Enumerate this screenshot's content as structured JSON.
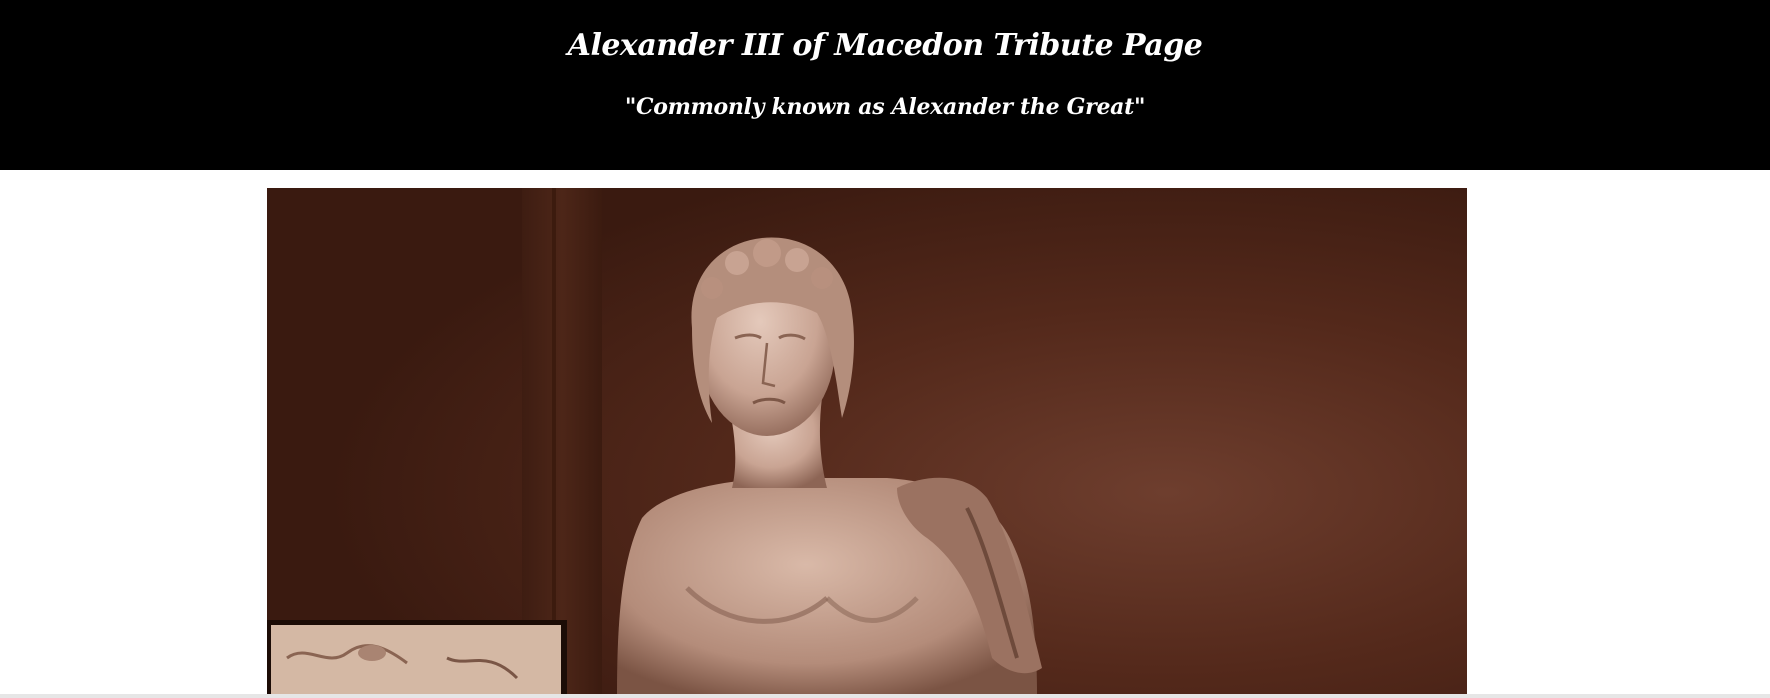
{
  "header": {
    "title": "Alexander III of Macedon Tribute Page",
    "subtitle": "\"Commonly known as Alexander the Great\""
  },
  "image": {
    "subject": "marble-statue-bust",
    "tone": "sepia"
  },
  "colors": {
    "header_bg": "#000000",
    "header_text": "#ffffff",
    "page_bg": "#ffffff",
    "photo_bg": "#4a2418"
  }
}
